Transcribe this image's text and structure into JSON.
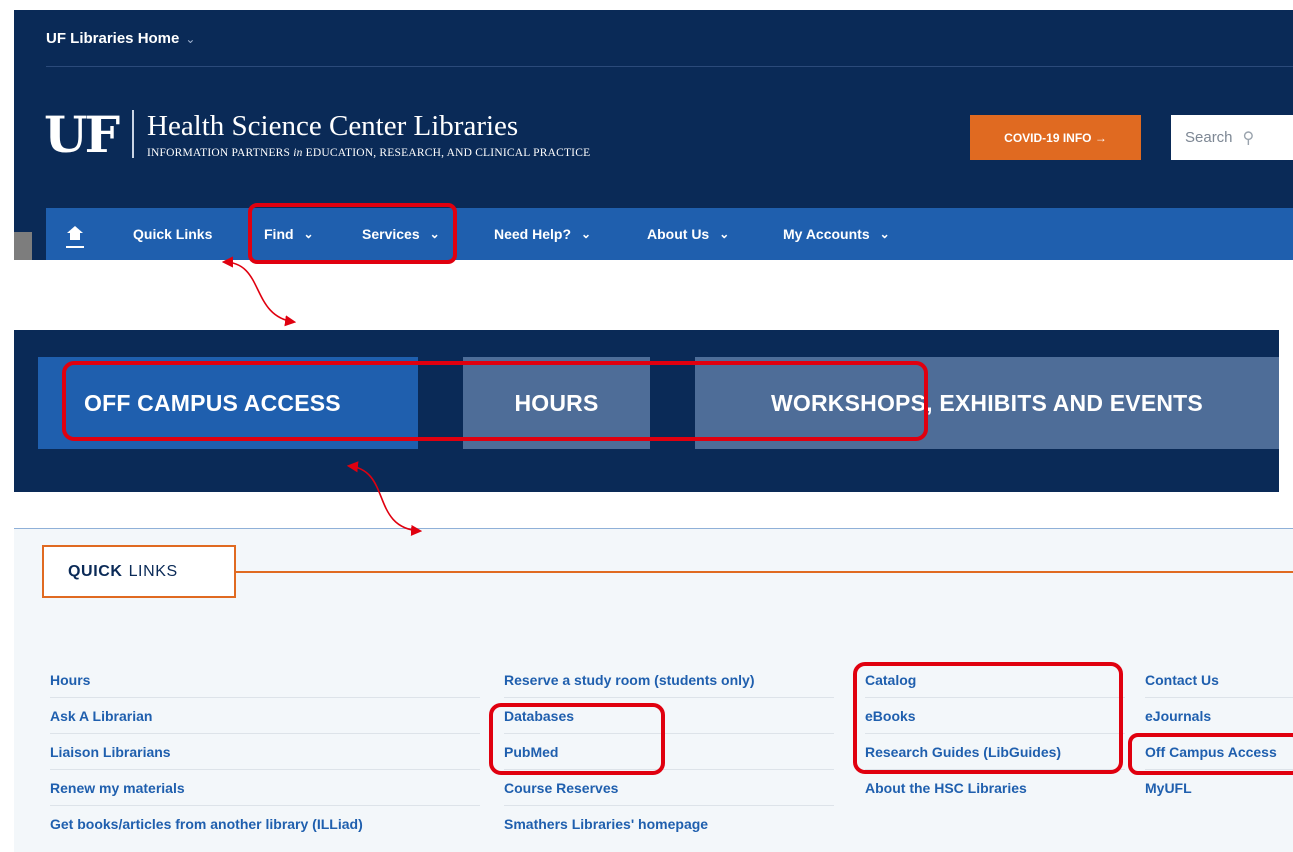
{
  "top_bar": {
    "home_link": "UF Libraries Home",
    "chevron": "⌄"
  },
  "brand": {
    "logo": "UF",
    "name": "Health Science Center Libraries",
    "tagline_a": "INFORMATION PARTNERS ",
    "tagline_em": "in",
    "tagline_b": " EDUCATION, RESEARCH, AND CLINICAL PRACTICE"
  },
  "covid_button": "COVID-19 INFO →",
  "search": {
    "placeholder": "Search",
    "icon": "search-icon",
    "glyph": "⚲"
  },
  "nav": {
    "home_icon": "home-icon",
    "items": [
      {
        "label": "Quick Links",
        "dropdown": ""
      },
      {
        "label": "Find",
        "dropdown": "⌄"
      },
      {
        "label": "Services",
        "dropdown": "⌄"
      },
      {
        "label": "Need Help?",
        "dropdown": "⌄"
      },
      {
        "label": "About Us",
        "dropdown": "⌄"
      },
      {
        "label": "My Accounts",
        "dropdown": "⌄"
      }
    ]
  },
  "quick_buttons": [
    "OFF CAMPUS ACCESS",
    "HOURS",
    "WORKSHOPS, EXHIBITS AND EVENTS"
  ],
  "quick_links": {
    "heading_bold": "QUICK",
    "heading_rest": "LINKS",
    "columns": [
      [
        "Hours",
        "Ask A Librarian",
        "Liaison Librarians",
        "Renew my materials",
        "Get books/articles from another library (ILLiad)"
      ],
      [
        "Reserve a study room (students only)",
        "Databases",
        "PubMed",
        "Course Reserves",
        "Smathers Libraries' homepage"
      ],
      [
        "Catalog",
        "eBooks",
        "Research Guides (LibGuides)",
        "About the HSC Libraries"
      ],
      [
        "Contact Us",
        "eJournals",
        "Off Campus Access",
        "MyUFL"
      ]
    ]
  },
  "colors": {
    "navy": "#0a2a57",
    "nav_blue": "#1f5fae",
    "button_slate": "#4e6d98",
    "orange": "#e06a21",
    "annotation_red": "#e0000f"
  }
}
